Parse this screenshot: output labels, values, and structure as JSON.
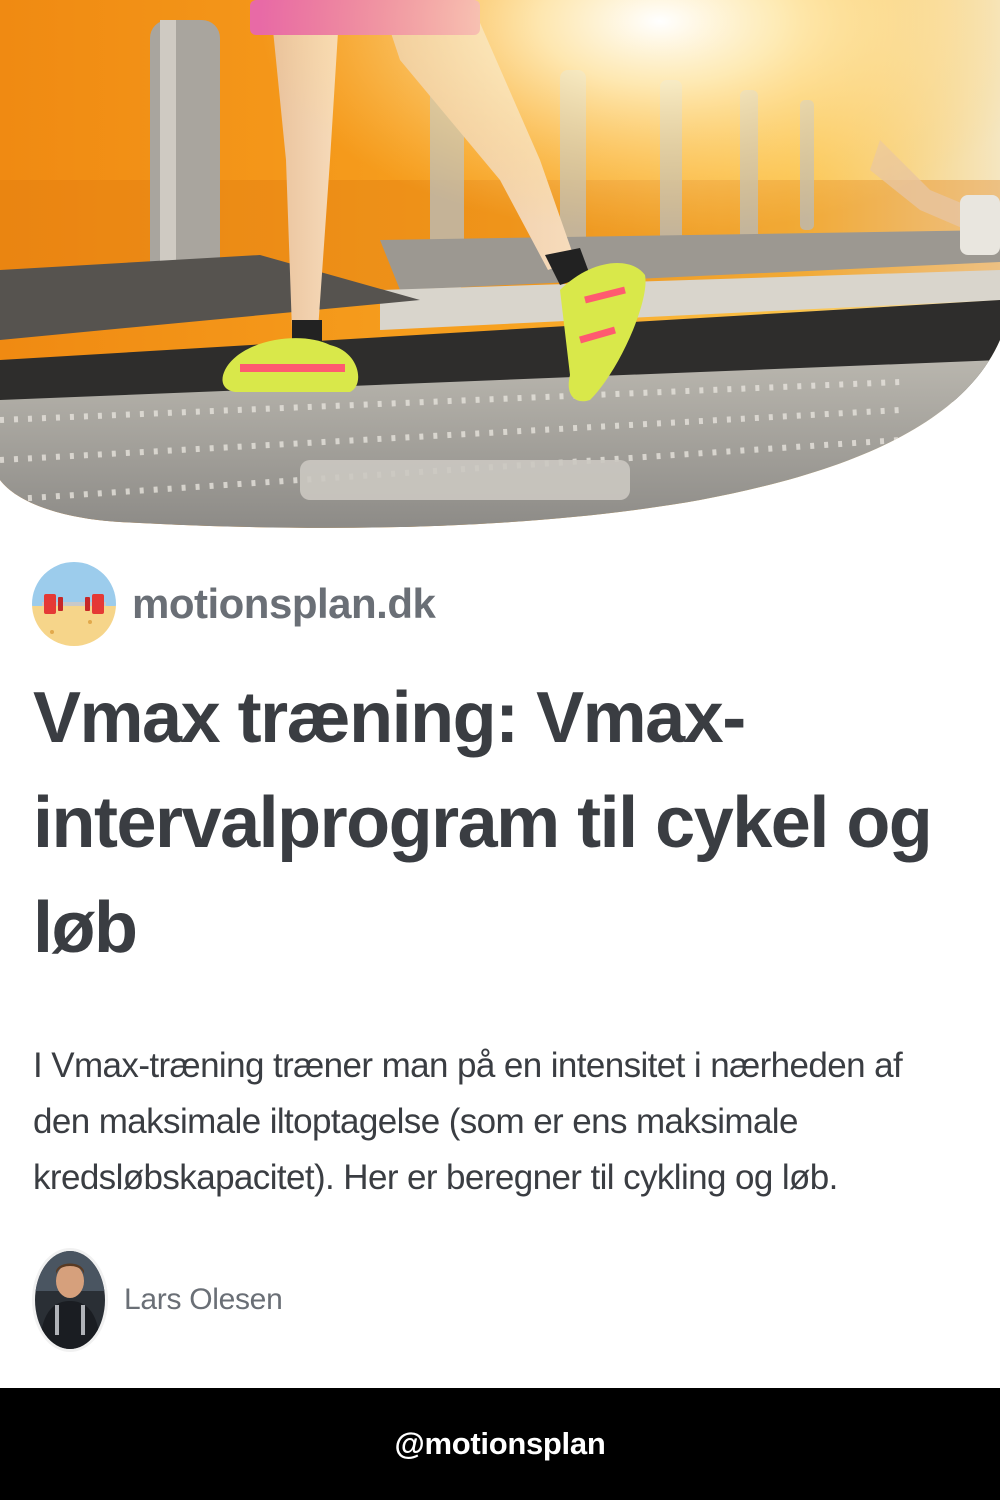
{
  "site": {
    "name": "motionsplan.dk"
  },
  "article": {
    "title": "Vmax træning: Vmax-intervalprogram til cykel og løb",
    "description": "I Vmax-træning træner man på en intensitet i nærheden af den maksimale iltoptagelse (som er ens maksimale kredsløbskapacitet). Her er beregner til cykling og løb."
  },
  "author": {
    "name": "Lars Olesen"
  },
  "footer": {
    "handle": "@motionsplan"
  },
  "colors": {
    "title": "#3a3d42",
    "muted": "#6a6f76",
    "footer_bg": "#000000",
    "hero_orange": "#f59a1c"
  }
}
